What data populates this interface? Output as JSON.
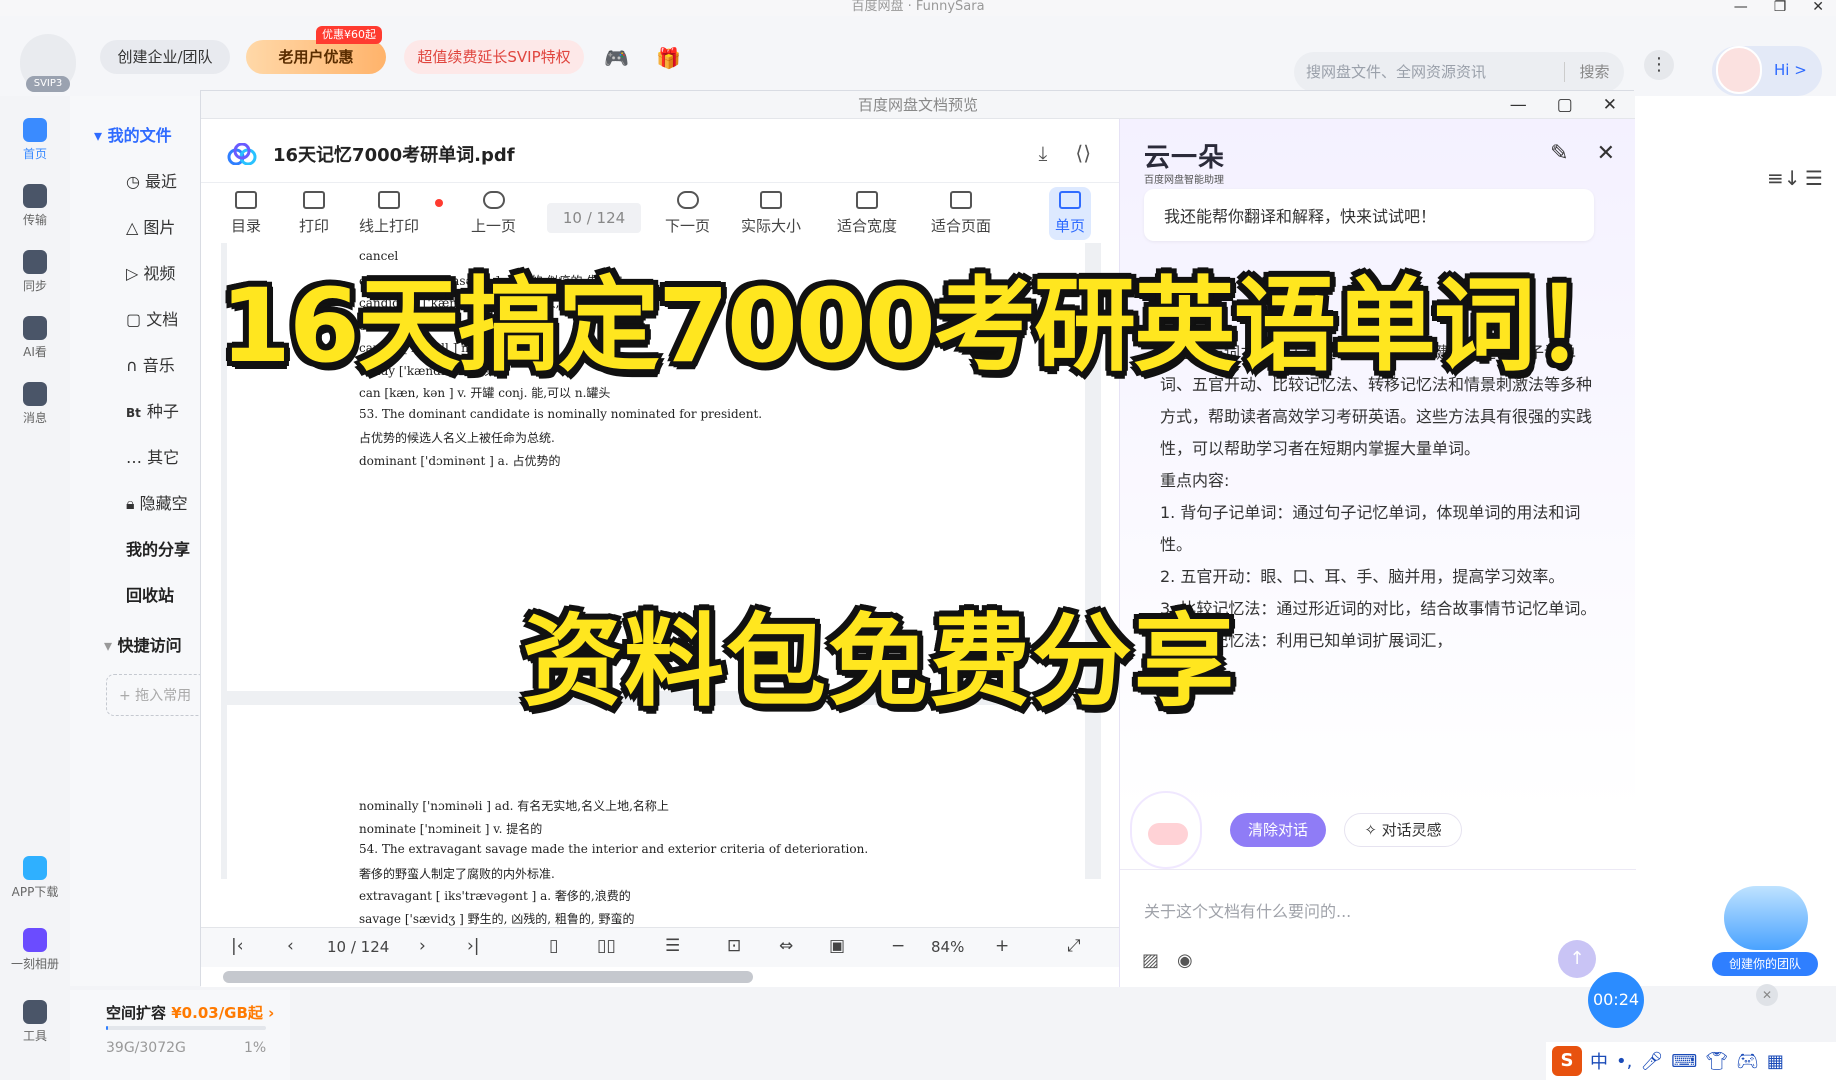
{
  "window": {
    "title": "百度网盘 · FunnySara"
  },
  "topbar": {
    "svip_badge": "SVIP3",
    "create_team": "创建企业/团队",
    "old_user": "老用户优惠",
    "old_user_tag": "优惠¥60起",
    "renew": "超值续费延长SVIP特权",
    "search_placeholder": "搜网盘文件、全网资源资讯",
    "search_button": "搜索",
    "hi": "Hi >"
  },
  "leftnav": [
    {
      "label": "首页"
    },
    {
      "label": "传输"
    },
    {
      "label": "同步"
    },
    {
      "label": "AI看"
    },
    {
      "label": "消息"
    },
    {
      "label": "APP下载"
    },
    {
      "label": "一刻相册"
    },
    {
      "label": "工具"
    }
  ],
  "filepanel": {
    "my_files": "我的文件",
    "items": [
      "最近",
      "图片",
      "视频",
      "文档",
      "音乐",
      "种子",
      "其它",
      "隐藏空"
    ],
    "bt_prefix": "Bt",
    "my_share": "我的分享",
    "recycle": "回收站",
    "quick_access": "快捷访问",
    "drag_hint": "+ 拖入常用"
  },
  "storage": {
    "label": "空间扩容",
    "price": "¥0.03/GB起",
    "used": "39G/3072G",
    "percent": "1%",
    "fill": 0.01
  },
  "viewer": {
    "title": "百度网盘文档预览",
    "filename": "16天记忆7000考研单词.pdf",
    "toolbar": [
      "目录",
      "打印",
      "线上打印",
      "上一页",
      "下一页",
      "实际大小",
      "适合宽度",
      "适合页面",
      "单页"
    ],
    "page_indicator": "10 / 124",
    "zoom": "84%",
    "page1_lines": [
      "cancel",
      "cancerous   ['kænsərəs ] a. 癌的,似癌的,生癌的",
      "candidate   ['kændideit ] n. 候选人,求职者",
      "canvas   ['kænvəs ] n. 帆布",
      "candle   ['kændl ] n. 蜡烛",
      "candy   ['kændi ] n. 糖果",
      "can   [kæn, kən ] v. 开罐 conj. 能,可以 n.罐头",
      "53. The dominant candidate is nominally nominated for president.",
      "占优势的候选人名义上被任命为总统.",
      "dominant   ['dɔminənt ] a. 占优势的"
    ],
    "page2_lines": [
      "nominally   ['nɔminəli ] ad. 有名无实地,名义上地,名称上",
      "nominate   ['nɔmineit ] v. 提名的",
      "54. The extravagant savage made the interior and exterior criteria of deterioration.",
      "奢侈的野蛮人制定了腐败的内外标准.",
      "extravagant   [ iks'trævəgənt ] a. 奢侈的,浪费的",
      "savage   ['sævidʒ ] 野生的, 凶残的, 粗鲁的, 野蛮的"
    ]
  },
  "ai": {
    "logo": "云一朵",
    "subtitle": "百度网盘智能助理",
    "greeting": "我还能帮你翻译和解释，快来试试吧！",
    "summary_lines": [
      "掌握词与词之间的关系是学习英语的关键。通过背句子记单词、五官开动、比较记忆法、转移记忆法和情景刺激法等多种方式，帮助读者高效学习考研英语。这些方法具有很强的实践性，可以帮助学习者在短期内掌握大量单词。",
      "重点内容:",
      "1. 背句子记单词：通过句子记忆单词，体现单词的用法和词性。",
      "2. 五官开动：眼、口、耳、手、脑并用，提高学习效率。",
      "3. 比较记忆法：通过形近词的对比，结合故事情节记忆单词。",
      "4. 转移记忆法：利用已知单词扩展词汇，"
    ],
    "clear_button": "清除对话",
    "inspire_button": "对话灵感",
    "input_placeholder": "关于这个文档有什么要问的..."
  },
  "team_badge": "创建你的团队",
  "timer": "00:24",
  "overlay": {
    "title": "16天搞定7000考研英语单词！",
    "subtitle": "资料包免费分享"
  }
}
